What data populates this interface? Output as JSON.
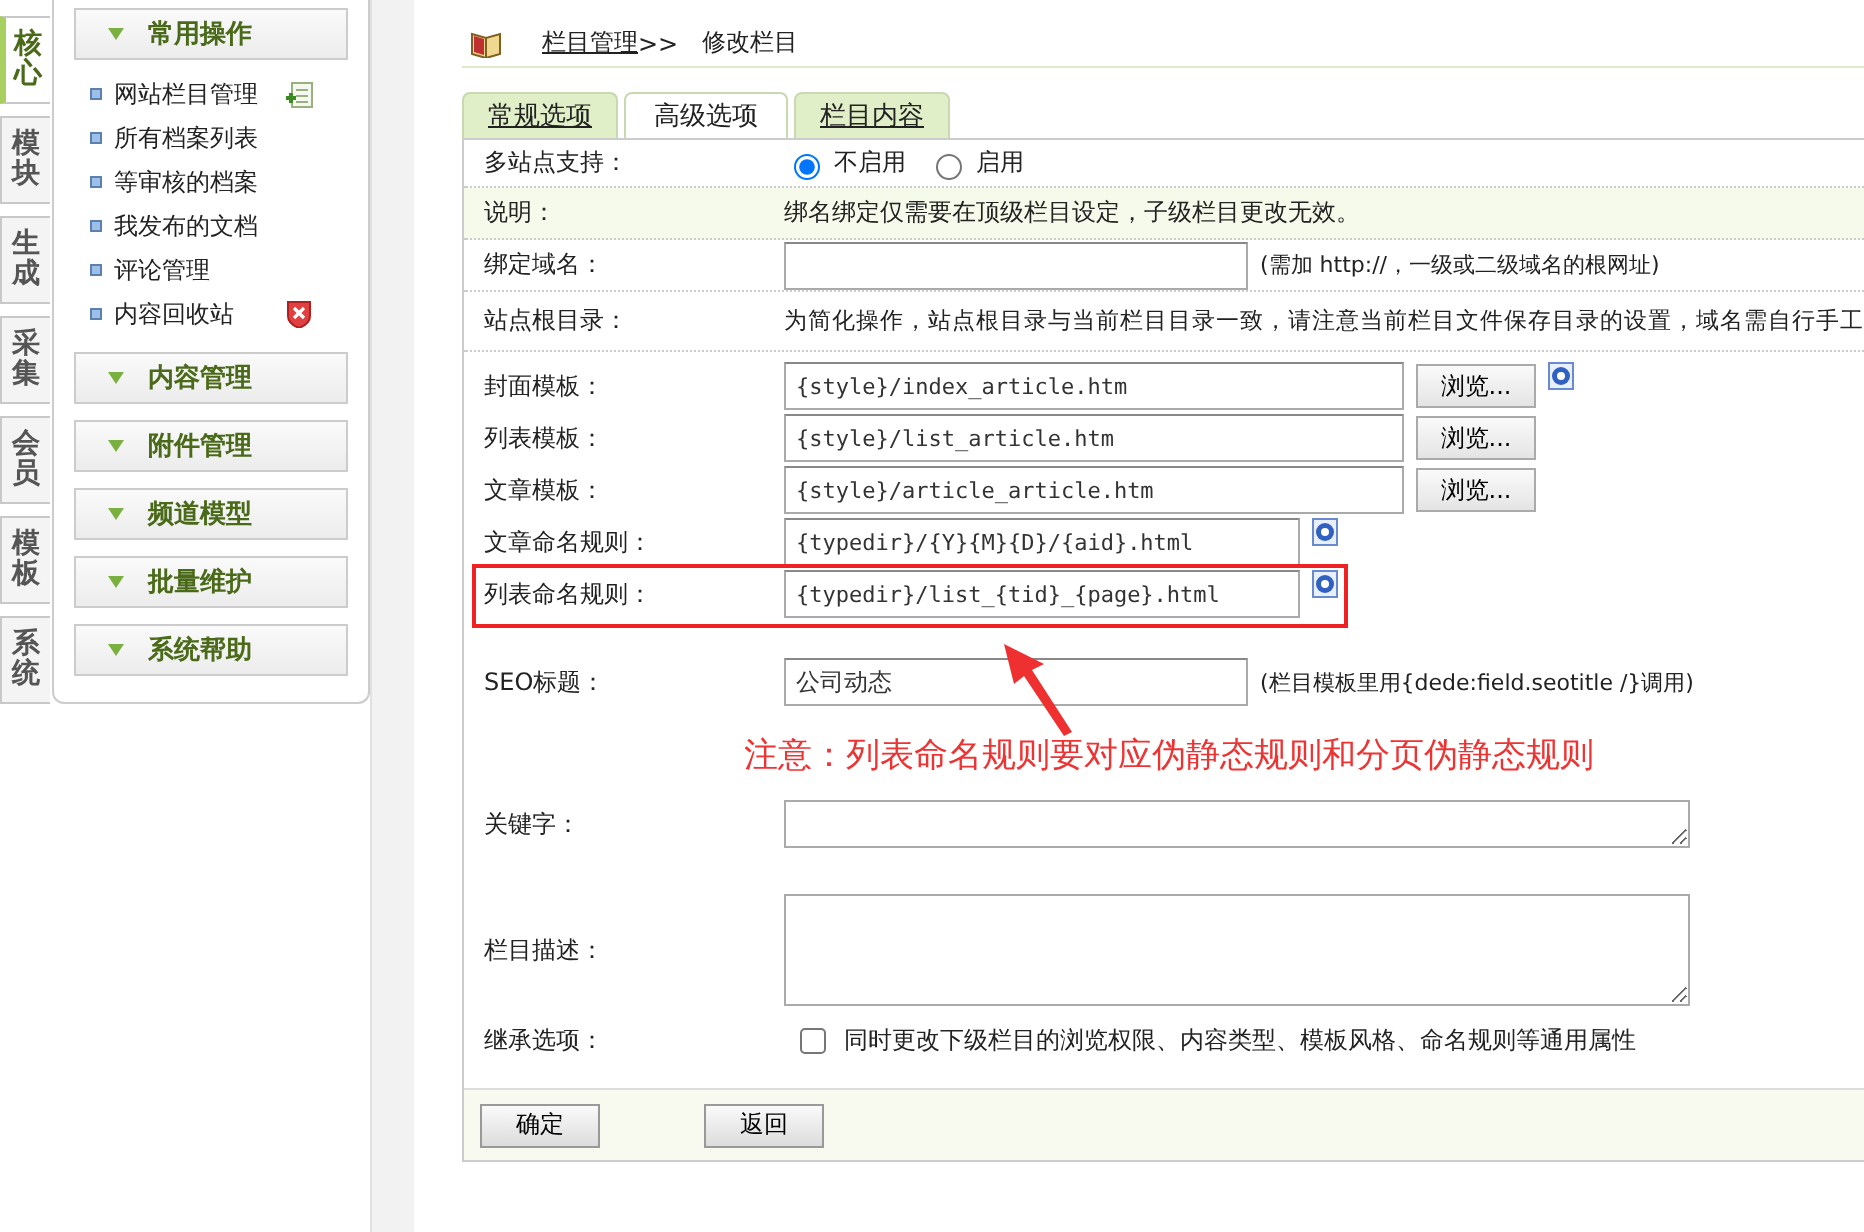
{
  "side_tabs": [
    {
      "label": "核心",
      "selected": true
    },
    {
      "label": "模块",
      "selected": false
    },
    {
      "label": "生成",
      "selected": false
    },
    {
      "label": "采集",
      "selected": false
    },
    {
      "label": "会员",
      "selected": false
    },
    {
      "label": "模板",
      "selected": false
    },
    {
      "label": "系统",
      "selected": false
    }
  ],
  "menu": [
    {
      "title": "常用操作",
      "items": [
        {
          "label": "网站栏目管理",
          "kind": "add"
        },
        {
          "label": "所有档案列表",
          "kind": "plain"
        },
        {
          "label": "等审核的档案",
          "kind": "plain"
        },
        {
          "label": "我发布的文档",
          "kind": "plain"
        },
        {
          "label": "评论管理",
          "kind": "plain"
        },
        {
          "label": "内容回收站",
          "kind": "delete"
        }
      ]
    },
    {
      "title": "内容管理"
    },
    {
      "title": "附件管理"
    },
    {
      "title": "频道模型"
    },
    {
      "title": "批量维护"
    },
    {
      "title": "系统帮助"
    }
  ],
  "breadcrumb": {
    "link": "栏目管理",
    "separator": ">>",
    "current": "修改栏目"
  },
  "tabs": [
    {
      "label": "常规选项",
      "selected": false
    },
    {
      "label": "高级选项",
      "selected": true
    },
    {
      "label": "栏目内容",
      "selected": false
    }
  ],
  "rows": [
    {
      "kind": "radio",
      "label": "多站点支持：",
      "options": [
        {
          "label": "不启用",
          "selected": true
        },
        {
          "label": "启用",
          "selected": false
        }
      ]
    },
    {
      "kind": "note",
      "label": "说明：",
      "text": "绑名绑定仅需要在顶级栏目设定，子级栏目更改无效。"
    },
    {
      "kind": "hint",
      "label": "绑定域名：",
      "value": "",
      "hint": "(需加 http://，一级或二级域名的根网址)"
    },
    {
      "kind": "text",
      "label": "站点根目录：",
      "text": "为简化操作，站点根目录与当前栏目目录一致，请注意当前栏目文件保存目录的设置，域名需自行手工"
    },
    {
      "kind": "template",
      "label": "封面模板：",
      "value": "{style}/index_article.htm",
      "button": "浏览...",
      "help": true
    },
    {
      "kind": "template",
      "label": "列表模板：",
      "value": "{style}/list_article.htm",
      "button": "浏览...",
      "help": false
    },
    {
      "kind": "template",
      "label": "文章模板：",
      "value": "{style}/article_article.htm",
      "button": "浏览...",
      "help": false
    },
    {
      "kind": "rule",
      "label": "文章命名规则：",
      "value": "{typedir}/{Y}{M}{D}/{aid}.html",
      "marked": false
    },
    {
      "kind": "rule",
      "label": "列表命名规则：",
      "value": "{typedir}/list_{tid}_{page}.html",
      "marked": true
    },
    {
      "kind": "hint",
      "label": "SEO标题：",
      "value": "公司动态",
      "hint": "(栏目模板里用{dede:field.seotitle /}调用)"
    },
    {
      "kind": "small-textarea",
      "label": "关键字：",
      "value": ""
    },
    {
      "kind": "textarea",
      "label": "栏目描述：",
      "value": ""
    },
    {
      "kind": "checkbox",
      "label": "继承选项：",
      "checked": false,
      "text": "同时更改下级栏目的浏览权限、内容类型、模板风格、命名规则等通用属性"
    }
  ],
  "annotation": "注意：列表命名规则要对应伪静态规则和分页伪静态规则",
  "buttons": [
    "确定",
    "返回"
  ]
}
